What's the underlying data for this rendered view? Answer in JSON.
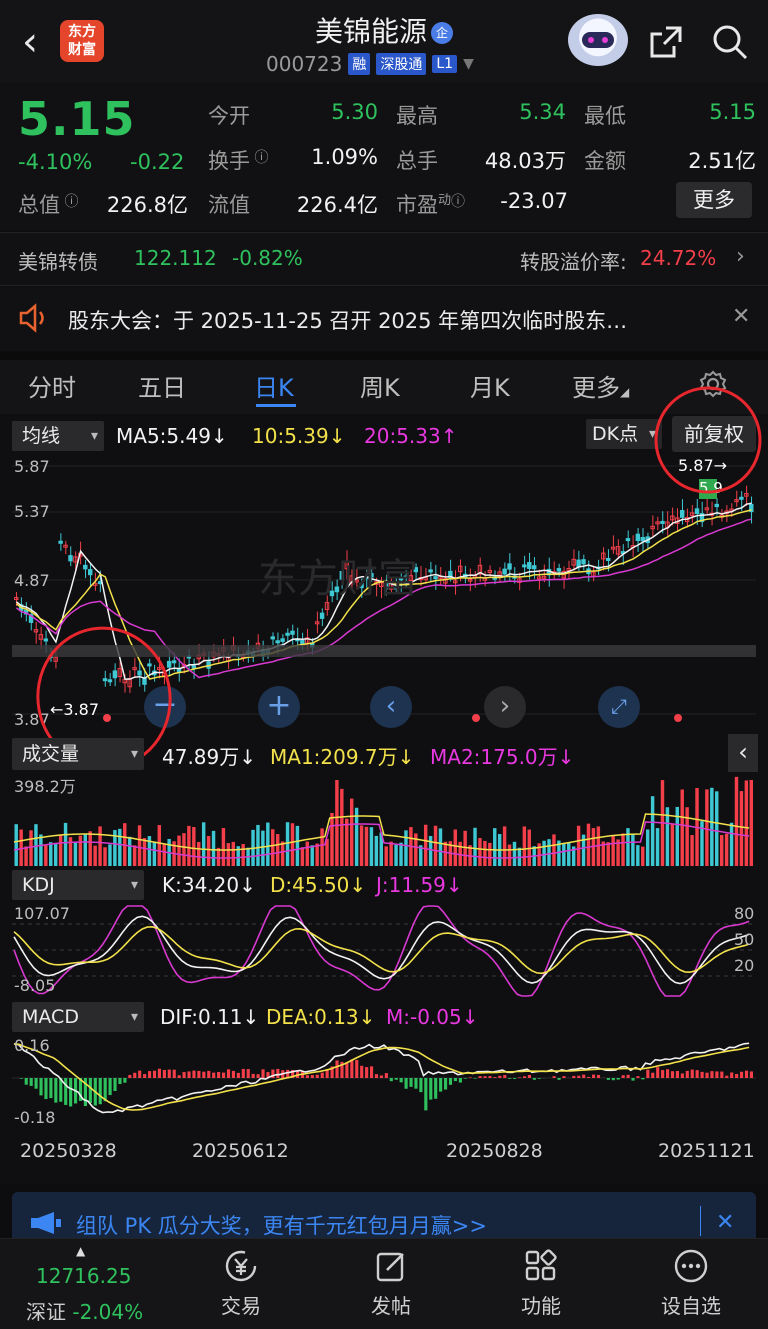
{
  "header": {
    "back": "‹",
    "logo_line1": "东方",
    "logo_line2": "财富",
    "stock_name": "美锦能源",
    "enterprise_badge": "企",
    "code": "000723",
    "tags": [
      "融",
      "深股通",
      "L1"
    ]
  },
  "quote": {
    "price": "5.15",
    "pct_change": "-4.10%",
    "change": "-0.22",
    "open_label": "今开",
    "open": "5.30",
    "high_label": "最高",
    "high": "5.34",
    "low_label": "最低",
    "low": "5.15",
    "turnover_label": "换手",
    "turnover": "1.09%",
    "volume_label": "总手",
    "volume": "48.03万",
    "amount_label": "金额",
    "amount": "2.51亿",
    "mcap_label": "总值",
    "mcap": "226.8亿",
    "float_label": "流值",
    "float_mcap": "226.4亿",
    "pe_label": "市盈",
    "pe_sup": "动",
    "pe": "-23.07",
    "more_label": "更多"
  },
  "bond": {
    "name": "美锦转债",
    "price": "122.112",
    "pct": "-0.82%",
    "premium_label": "转股溢价率:",
    "premium": "24.72%"
  },
  "notice": {
    "text": "股东大会：于 2025-11-25 召开 2025 年第四次临时股东…"
  },
  "tabs": [
    "分时",
    "五日",
    "日K",
    "周K",
    "月K",
    "更多"
  ],
  "active_tab": "日K",
  "kline": {
    "ma_selector": "均线",
    "ma5": "MA5:5.49↓",
    "ma10": "10:5.39↓",
    "ma20": "20:5.33↑",
    "dk_label": "DK点",
    "adjust_label": "前复权",
    "y_high": "5.87",
    "y_mid1": "5.37",
    "y_mid2": "4.87",
    "y_low": "3.87",
    "max_marker": "5.87→",
    "min_marker": "←3.87",
    "dk_high_val": "5.9"
  },
  "volume": {
    "selector": "成交量",
    "val": "47.89万↓",
    "ma1": "MA1:209.7万↓",
    "ma2": "MA2:175.0万↓",
    "y_max": "398.2万"
  },
  "kdj": {
    "selector": "KDJ",
    "k": "K:34.20↓",
    "d": "D:45.50↓",
    "j": "J:11.59↓",
    "y_top": "107.07",
    "y_bot": "-8.05",
    "r80": "80",
    "r50": "50",
    "r20": "20"
  },
  "macd": {
    "selector": "MACD",
    "dif": "DIF:0.11↓",
    "dea": "DEA:0.13↓",
    "m": "M:-0.05↓",
    "y_top": "0.16",
    "y_bot": "-0.18"
  },
  "dates": [
    "20250328",
    "20250612",
    "20250828",
    "20251121"
  ],
  "banner": {
    "text": "组队 PK 瓜分大奖，更有千元红包月月赢>>"
  },
  "bottom": {
    "index_value": "12716.25",
    "index_name": "深证",
    "index_pct": "-2.04%",
    "nav": [
      "交易",
      "发帖",
      "功能",
      "设自选"
    ]
  },
  "colors": {
    "up": "#f23f4a",
    "down": "#2fc15e",
    "accent": "#3b86f2",
    "ma5": "#f2f2f2",
    "ma10": "#f2e14a",
    "ma20": "#e838e0"
  }
}
